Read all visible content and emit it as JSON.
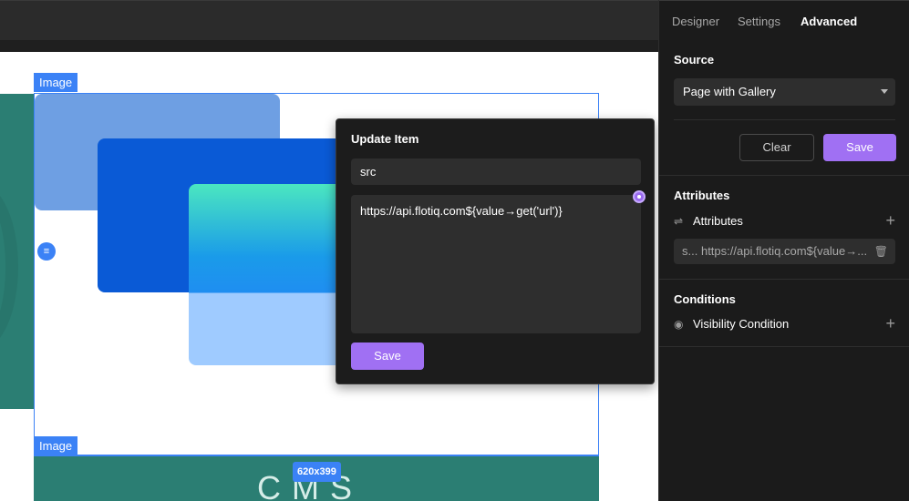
{
  "panel": {
    "tabs": [
      "Designer",
      "Settings",
      "Advanced"
    ],
    "source": {
      "title": "Source",
      "selected": "Page with Gallery",
      "clear_label": "Clear",
      "save_label": "Save"
    },
    "attributes": {
      "title": "Attributes",
      "row_label": "Attributes",
      "item_key": "s...",
      "item_value": "https://api.flotiq.com${value→..."
    },
    "conditions": {
      "title": "Conditions",
      "row_label": "Visibility Condition"
    }
  },
  "popup": {
    "title": "Update Item",
    "key": "src",
    "value": "https://api.flotiq.com${value→get('url')}",
    "save_label": "Save"
  },
  "canvas": {
    "image_label_top": "Image",
    "image_label_bottom": "Image",
    "size_badge": "620x399",
    "cms_text": "CMS"
  },
  "icons": {
    "handle": "list-icon",
    "dropdown": "caret-down-icon",
    "attributes": "sliders-icon",
    "visibility": "eye-icon",
    "add": "plus-icon",
    "delete": "trash-icon",
    "binding": "dynamic-binding-icon"
  },
  "colors": {
    "accent": "#a070f3",
    "selection": "#3b82f6",
    "panel_bg": "#1b1b1b"
  }
}
